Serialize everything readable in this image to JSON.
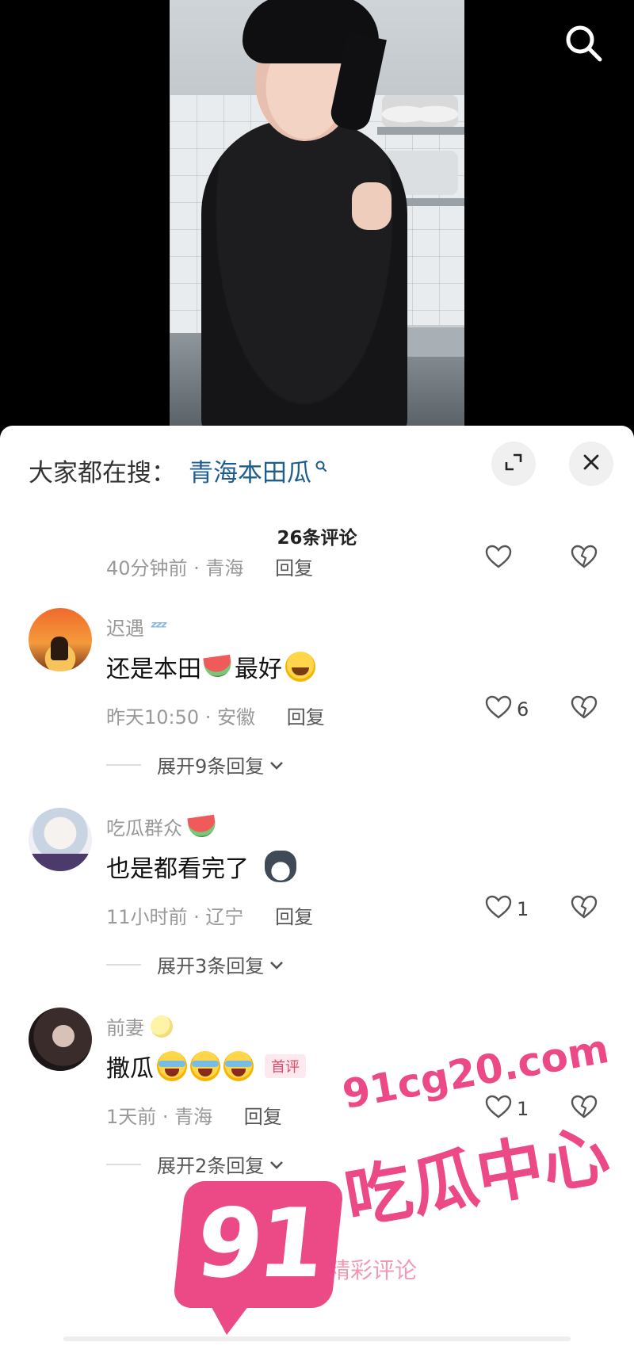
{
  "video": {
    "search_icon": "search-icon"
  },
  "searchbar": {
    "prefix": "大家都在搜：",
    "term": "青海本田瓜",
    "expand_icon": "expand-icon",
    "close_icon": "close-icon"
  },
  "comments_header": {
    "count_label": "26条评论"
  },
  "previous_comment": {
    "meta": "40分钟前 · 青海",
    "reply_label": "回复"
  },
  "comments": [
    {
      "username": "迟遇",
      "text": "还是本田",
      "text_suffix": "最好",
      "meta": "昨天10:50 · 安徽",
      "reply_label": "回复",
      "likes": "6",
      "expand_label": "展开9条回复"
    },
    {
      "username": "吃瓜群众",
      "text": "也是都看完了",
      "meta": "11小时前 · 辽宁",
      "reply_label": "回复",
      "likes": "1",
      "expand_label": "展开3条回复"
    },
    {
      "username": "前妻",
      "text": "撒瓜",
      "badge": "首评",
      "meta": "1天前 · 青海",
      "reply_label": "回复",
      "likes": "1",
      "expand_label": "展开2条回复"
    }
  ],
  "login_hint": "登录看更多精彩评论",
  "watermark": {
    "number": "91",
    "url": "91cg20.com",
    "name": "吃瓜中心"
  },
  "colors": {
    "accent_link": "#1d5e8c",
    "watermark_pink": "#ec4a86",
    "badge_pink": "#e0486b"
  }
}
